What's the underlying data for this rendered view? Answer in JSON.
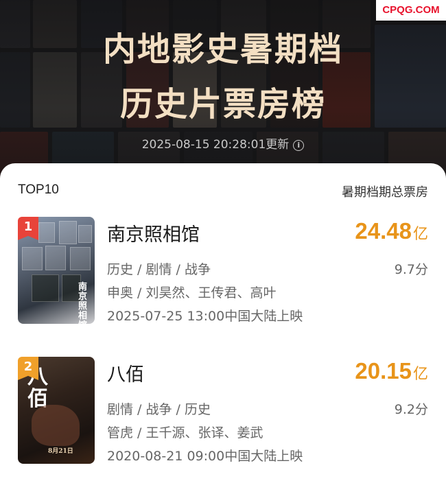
{
  "watermark": "CPQG.COM",
  "header": {
    "title_line1": "内地影史暑期档",
    "title_line2": "历史片票房榜",
    "updated": "2025-08-15 20:28:01更新"
  },
  "list": {
    "left_label": "TOP10",
    "right_label": "暑期档期总票房",
    "items": [
      {
        "rank": "1",
        "title": "南京照相馆",
        "box_office": "24.48",
        "box_unit": "亿",
        "genres": "历史 / 剧情 / 战争",
        "score": "9.7分",
        "cast": "申奥 / 刘昊然、王传君、高叶",
        "release": "2025-07-25 13:00中国大陆上映",
        "badge_color": "#e8433a"
      },
      {
        "rank": "2",
        "title": "八佰",
        "box_office": "20.15",
        "box_unit": "亿",
        "genres": "剧情 / 战争 / 历史",
        "score": "9.2分",
        "cast": "管虎 / 王千源、张译、姜武",
        "release": "2020-08-21 09:00中国大陆上映",
        "badge_color": "#f0a02a"
      }
    ]
  },
  "colors": {
    "box_office": "#e8941a",
    "title_gold": "#f3dfc3",
    "watermark_red": "#e8122c"
  }
}
